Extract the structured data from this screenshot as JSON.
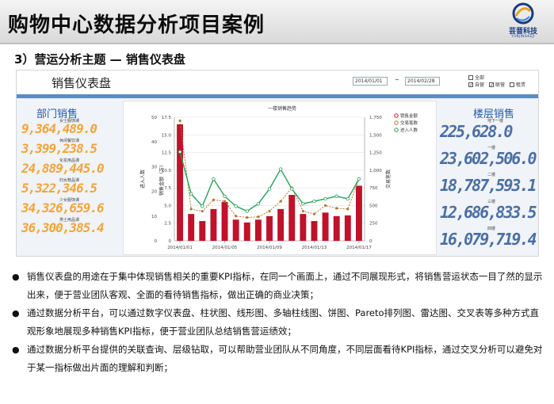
{
  "header": {
    "title": "购物中心数据分析项目案例",
    "logo_text": "芸晋科技",
    "logo_sub": "YUNJINGKEJI"
  },
  "section": {
    "subtitle": "3）营运分析主题 — 销售仪表盘"
  },
  "dashboard": {
    "title": "销售仪表盘",
    "date_from": "2014/01/01",
    "date_sep": "~",
    "date_to": "2014/02/28",
    "checkboxes": [
      {
        "label": "全部",
        "checked": false
      },
      {
        "label": "自营",
        "checked": true
      },
      {
        "label": "联营",
        "checked": true
      },
      {
        "label": "租赁",
        "checked": false
      }
    ],
    "departments": {
      "title": "部门销售",
      "items": [
        {
          "label": "女士服饰课",
          "value": "9,364,489.0"
        },
        {
          "label": "休闲餐饮课",
          "value": "3,399,238.5"
        },
        {
          "label": "化妆用品课",
          "value": "24,889,445.0"
        },
        {
          "label": "妇女鞋品课",
          "value": "5,322,346.5"
        },
        {
          "label": "少女服饰课",
          "value": "34,326,659.6"
        },
        {
          "label": "男士用品课",
          "value": "36,300,385.4"
        }
      ]
    },
    "floors": {
      "title": "楼层销售",
      "items": [
        {
          "label": "地下一楼",
          "value": "225,628.0"
        },
        {
          "label": "一楼",
          "value": "23,602,506.0"
        },
        {
          "label": "二楼",
          "value": "18,787,593.1"
        },
        {
          "label": "三楼",
          "value": "12,686,833.5"
        },
        {
          "label": "四楼",
          "value": "16,079,719.4"
        }
      ]
    }
  },
  "chart_data": {
    "type": "bar",
    "title": "一楼销售趋势",
    "x_tick_labels": [
      "2014/01/01",
      "2014/01/05",
      "2014/01/09",
      "2014/01/13",
      "2014/01/17"
    ],
    "y_left_ticks": [
      "0",
      "10",
      "20",
      "30",
      "40",
      "50"
    ],
    "y_left_label": "进入人数",
    "y_inner_ticks": [
      "0",
      "2.5",
      "5.0",
      "7.5",
      "10.0",
      "12.5",
      "15.0",
      "17.5"
    ],
    "y_inner_label": "销售金额（万）",
    "y_right_ticks": [
      "0",
      "250",
      "500",
      "750",
      "1,000",
      "1,250",
      "1,500",
      "1,750"
    ],
    "y_right_label": "交易笔数",
    "inner_ylim": [
      0,
      17.5
    ],
    "right_ylim": [
      0,
      1750
    ],
    "legend_position": "top-right",
    "colors": {
      "bar": "#c0122a",
      "trades": "#b07830",
      "visitors": "#27a05a"
    },
    "series": [
      {
        "name": "销售金额",
        "axis": "inner",
        "values": [
          16.5,
          3.8,
          2.8,
          4.5,
          5.5,
          3.0,
          2.6,
          3.0,
          3.5,
          4.5,
          6.5,
          3.8,
          2.8,
          4.0,
          3.5,
          3.6,
          7.8
        ]
      },
      {
        "name": "交易笔数",
        "axis": "right",
        "values": [
          1700,
          450,
          420,
          580,
          560,
          350,
          330,
          340,
          420,
          560,
          750,
          420,
          380,
          500,
          460,
          450,
          880
        ]
      },
      {
        "name": "进入人数",
        "axis": "left",
        "values": [
          36,
          19,
          14,
          25,
          18,
          14,
          12,
          15,
          21,
          29,
          21,
          15,
          16,
          17,
          18,
          17,
          25
        ]
      }
    ]
  },
  "bullets": [
    {
      "symbol": "●",
      "text": "销售仪表盘的用途在于集中体现销售相关的重要KPI指标，在同一个画面上，通过不同展现形式，将销售营运状态一目了然的显示出来，便于营业团队客观、全面的看待销售指标，做出正确的商业决策；"
    },
    {
      "symbol": "●",
      "text": "通过数据分析平台，可以通过数字仪表盘、柱状图、线形图、多轴柱线图、饼图、Pareto排列图、雷达图、交叉表等多种方式直观形象地展现多种销售KPI指标，便于营业团队总结销售营运绩效；"
    },
    {
      "symbol": "●",
      "text": "通过数据分析平台提供的关联查询、层级钻取，可以帮助营业团队从不同角度，不同层面看待KPI指标，通过交叉分析可以避免对于某一指标做出片面的理解和判断；"
    }
  ]
}
